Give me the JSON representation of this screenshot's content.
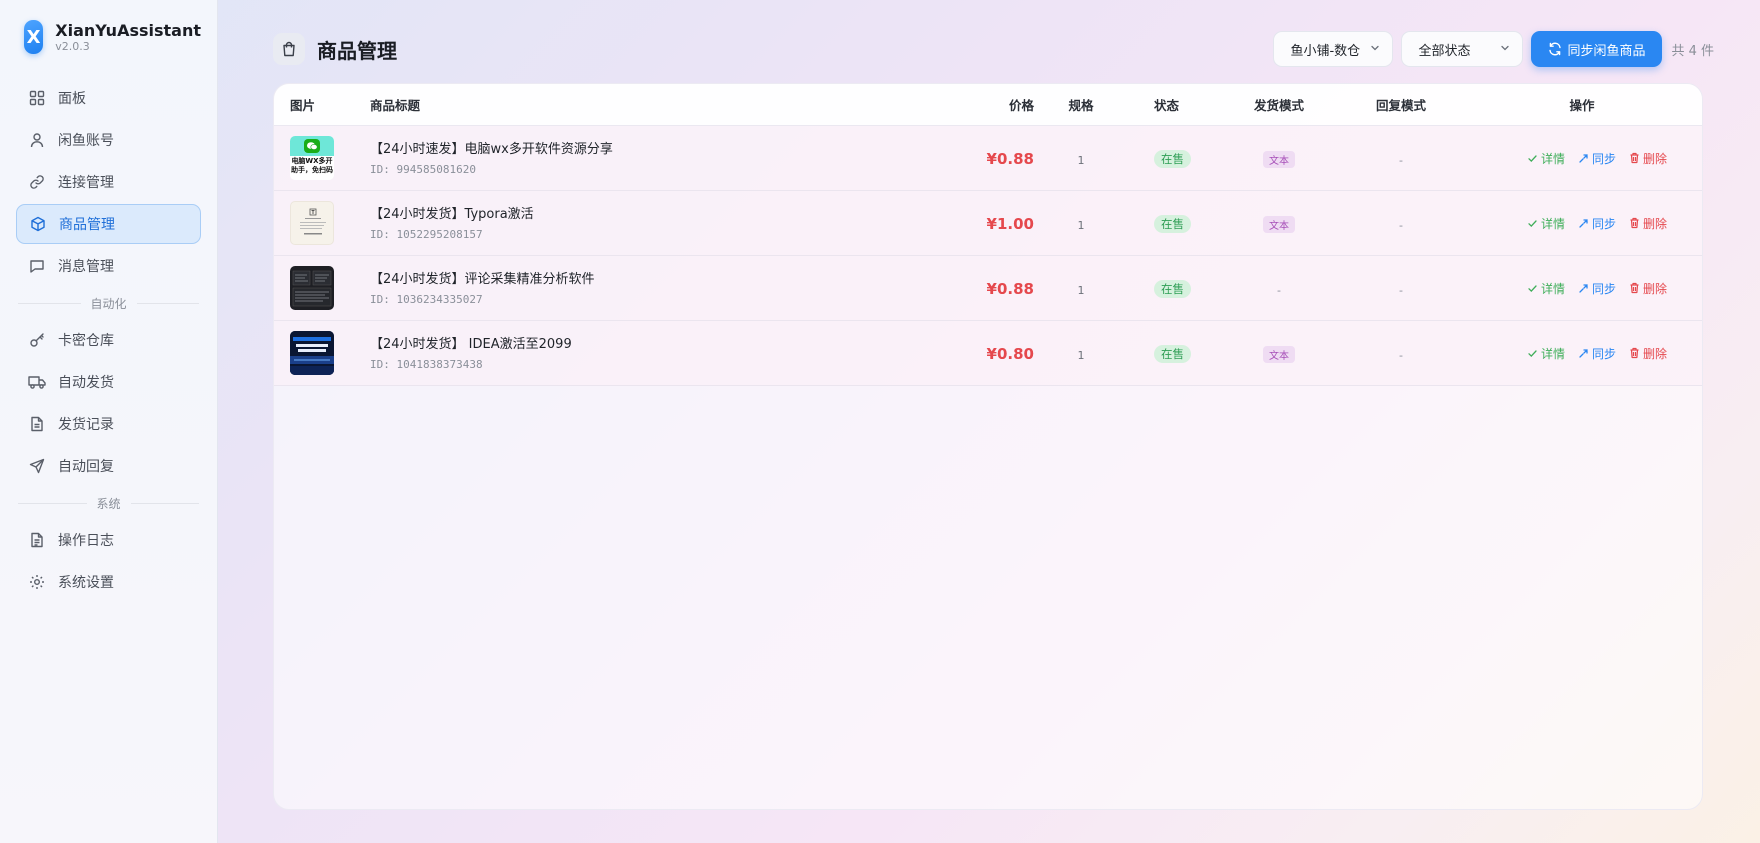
{
  "brand": {
    "logo_letter": "X",
    "name": "XianYuAssistant",
    "version": "v2.0.3"
  },
  "sidebar": {
    "items": [
      {
        "label": "面板",
        "icon": "grid-icon"
      },
      {
        "label": "闲鱼账号",
        "icon": "user-icon"
      },
      {
        "label": "连接管理",
        "icon": "link-icon"
      },
      {
        "label": "商品管理",
        "icon": "box-icon",
        "active": true
      },
      {
        "label": "消息管理",
        "icon": "chat-icon"
      }
    ],
    "group_automation": "自动化",
    "automation_items": [
      {
        "label": "卡密仓库",
        "icon": "key-icon"
      },
      {
        "label": "自动发货",
        "icon": "truck-icon"
      },
      {
        "label": "发货记录",
        "icon": "document-icon"
      },
      {
        "label": "自动回复",
        "icon": "send-icon"
      }
    ],
    "group_system": "系统",
    "system_items": [
      {
        "label": "操作日志",
        "icon": "log-icon"
      },
      {
        "label": "系统设置",
        "icon": "gear-icon"
      }
    ]
  },
  "header": {
    "title": "商品管理",
    "shop_select": "鱼小铺-数仓",
    "status_select": "全部状态",
    "sync_button": "同步闲鱼商品",
    "count_text": "共 4 件"
  },
  "table": {
    "columns": {
      "image": "图片",
      "title": "商品标题",
      "price": "价格",
      "spec": "规格",
      "status": "状态",
      "ship_mode": "发货模式",
      "reply_mode": "回复模式",
      "ops": "操作"
    },
    "ops_labels": {
      "detail": "详情",
      "sync": "同步",
      "delete": "删除"
    },
    "rows": [
      {
        "title": "【24小时速发】电脑wx多开软件资源分享",
        "id": "ID: 994585081620",
        "price": "¥0.88",
        "spec": "1",
        "status": "在售",
        "ship_mode": "文本",
        "reply_mode": "-",
        "thumb_text": "电脑WX多开助手，免扫码"
      },
      {
        "title": "【24小时发货】Typora激活",
        "id": "ID: 1052295208157",
        "price": "¥1.00",
        "spec": "1",
        "status": "在售",
        "ship_mode": "文本",
        "reply_mode": "-"
      },
      {
        "title": "【24小时发货】评论采集精准分析软件",
        "id": "ID: 1036234335027",
        "price": "¥0.88",
        "spec": "1",
        "status": "在售",
        "ship_mode": "-",
        "reply_mode": "-"
      },
      {
        "title": "【24小时发货】 IDEA激活至2099",
        "id": "ID: 1041838373438",
        "price": "¥0.80",
        "spec": "1",
        "status": "在售",
        "ship_mode": "文本",
        "reply_mode": "-"
      }
    ]
  },
  "colors": {
    "accent": "#2a87f2",
    "price": "#e5484d",
    "status_green": "#2f9e55",
    "tag_purple": "#a74fb8"
  }
}
